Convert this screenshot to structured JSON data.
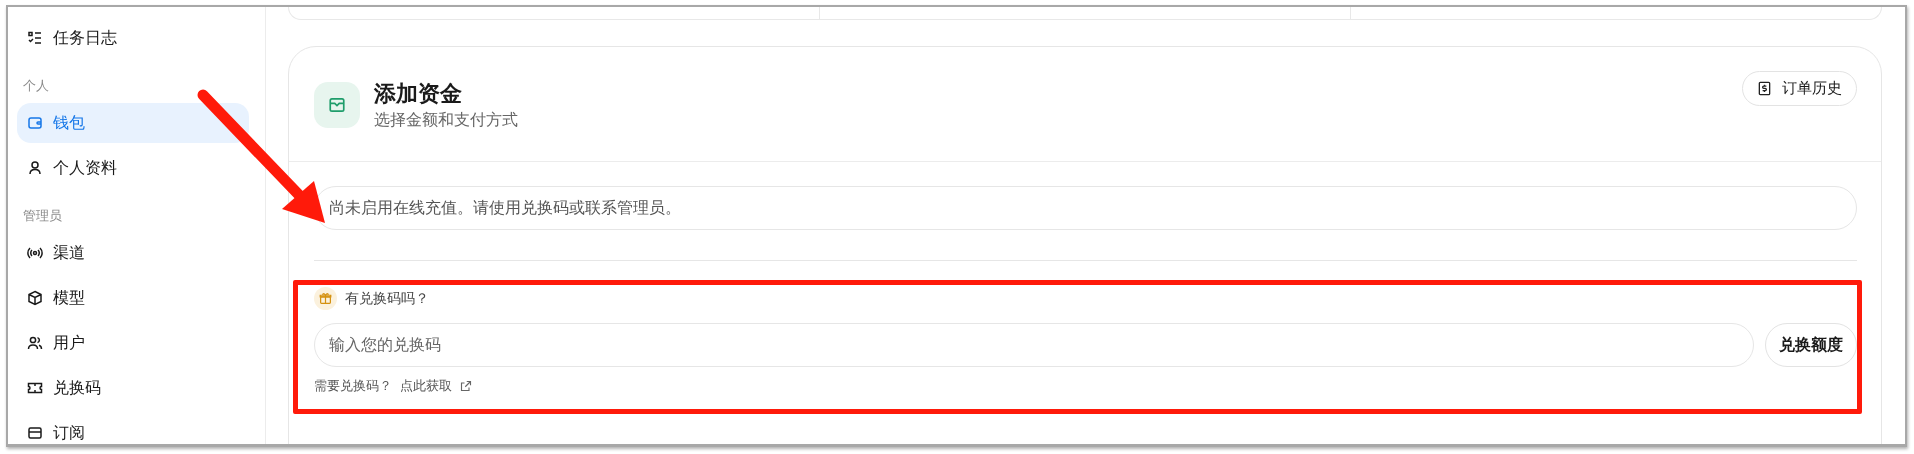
{
  "sidebar": {
    "top_items": [
      {
        "label": "任务日志",
        "selected": false
      }
    ],
    "sections": [
      {
        "heading": "个人",
        "items": [
          {
            "label": "钱包",
            "selected": true
          },
          {
            "label": "个人资料",
            "selected": false
          }
        ]
      },
      {
        "heading": "管理员",
        "items": [
          {
            "label": "渠道",
            "selected": false
          },
          {
            "label": "模型",
            "selected": false
          },
          {
            "label": "用户",
            "selected": false
          },
          {
            "label": "兑换码",
            "selected": false
          },
          {
            "label": "订阅",
            "selected": false
          }
        ]
      }
    ]
  },
  "add_funds": {
    "title": "添加资金",
    "subtitle": "选择金额和支付方式",
    "order_history_button": "订单历史",
    "notice": "尚未启用在线充值。请使用兑换码或联系管理员。",
    "redeem": {
      "label": "有兑换码吗？",
      "input": {
        "placeholder": "输入您的兑换码"
      },
      "button": "兑换额度",
      "help_text": "需要兑换码？",
      "help_link": "点此获取"
    }
  },
  "annotations": {
    "arrow": true,
    "highlight_frame": true
  }
}
